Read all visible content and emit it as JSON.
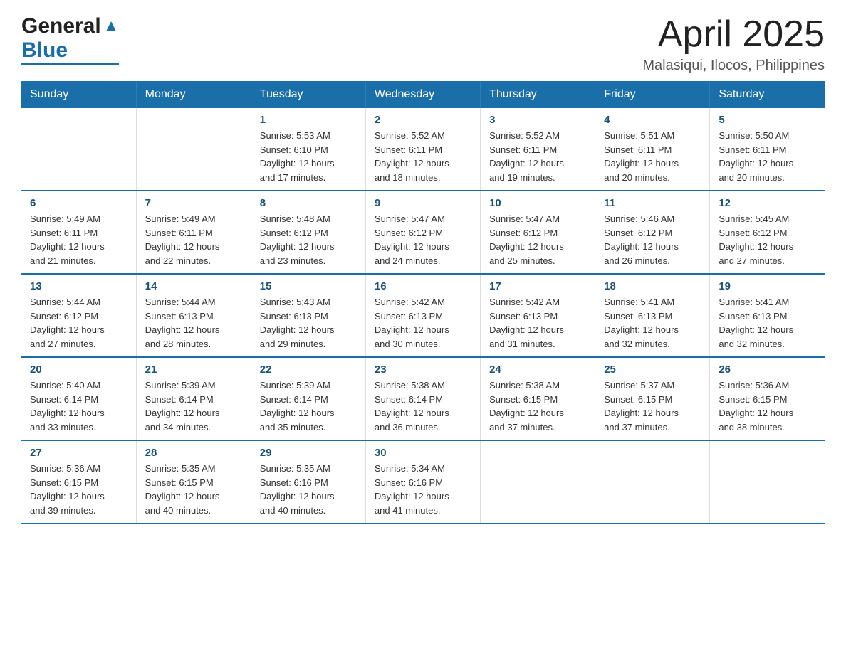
{
  "header": {
    "logo_general": "General",
    "logo_blue": "Blue",
    "title": "April 2025",
    "location": "Malasiqui, Ilocos, Philippines"
  },
  "days_of_week": [
    "Sunday",
    "Monday",
    "Tuesday",
    "Wednesday",
    "Thursday",
    "Friday",
    "Saturday"
  ],
  "weeks": [
    [
      {
        "day": "",
        "info": ""
      },
      {
        "day": "",
        "info": ""
      },
      {
        "day": "1",
        "info": "Sunrise: 5:53 AM\nSunset: 6:10 PM\nDaylight: 12 hours\nand 17 minutes."
      },
      {
        "day": "2",
        "info": "Sunrise: 5:52 AM\nSunset: 6:11 PM\nDaylight: 12 hours\nand 18 minutes."
      },
      {
        "day": "3",
        "info": "Sunrise: 5:52 AM\nSunset: 6:11 PM\nDaylight: 12 hours\nand 19 minutes."
      },
      {
        "day": "4",
        "info": "Sunrise: 5:51 AM\nSunset: 6:11 PM\nDaylight: 12 hours\nand 20 minutes."
      },
      {
        "day": "5",
        "info": "Sunrise: 5:50 AM\nSunset: 6:11 PM\nDaylight: 12 hours\nand 20 minutes."
      }
    ],
    [
      {
        "day": "6",
        "info": "Sunrise: 5:49 AM\nSunset: 6:11 PM\nDaylight: 12 hours\nand 21 minutes."
      },
      {
        "day": "7",
        "info": "Sunrise: 5:49 AM\nSunset: 6:11 PM\nDaylight: 12 hours\nand 22 minutes."
      },
      {
        "day": "8",
        "info": "Sunrise: 5:48 AM\nSunset: 6:12 PM\nDaylight: 12 hours\nand 23 minutes."
      },
      {
        "day": "9",
        "info": "Sunrise: 5:47 AM\nSunset: 6:12 PM\nDaylight: 12 hours\nand 24 minutes."
      },
      {
        "day": "10",
        "info": "Sunrise: 5:47 AM\nSunset: 6:12 PM\nDaylight: 12 hours\nand 25 minutes."
      },
      {
        "day": "11",
        "info": "Sunrise: 5:46 AM\nSunset: 6:12 PM\nDaylight: 12 hours\nand 26 minutes."
      },
      {
        "day": "12",
        "info": "Sunrise: 5:45 AM\nSunset: 6:12 PM\nDaylight: 12 hours\nand 27 minutes."
      }
    ],
    [
      {
        "day": "13",
        "info": "Sunrise: 5:44 AM\nSunset: 6:12 PM\nDaylight: 12 hours\nand 27 minutes."
      },
      {
        "day": "14",
        "info": "Sunrise: 5:44 AM\nSunset: 6:13 PM\nDaylight: 12 hours\nand 28 minutes."
      },
      {
        "day": "15",
        "info": "Sunrise: 5:43 AM\nSunset: 6:13 PM\nDaylight: 12 hours\nand 29 minutes."
      },
      {
        "day": "16",
        "info": "Sunrise: 5:42 AM\nSunset: 6:13 PM\nDaylight: 12 hours\nand 30 minutes."
      },
      {
        "day": "17",
        "info": "Sunrise: 5:42 AM\nSunset: 6:13 PM\nDaylight: 12 hours\nand 31 minutes."
      },
      {
        "day": "18",
        "info": "Sunrise: 5:41 AM\nSunset: 6:13 PM\nDaylight: 12 hours\nand 32 minutes."
      },
      {
        "day": "19",
        "info": "Sunrise: 5:41 AM\nSunset: 6:13 PM\nDaylight: 12 hours\nand 32 minutes."
      }
    ],
    [
      {
        "day": "20",
        "info": "Sunrise: 5:40 AM\nSunset: 6:14 PM\nDaylight: 12 hours\nand 33 minutes."
      },
      {
        "day": "21",
        "info": "Sunrise: 5:39 AM\nSunset: 6:14 PM\nDaylight: 12 hours\nand 34 minutes."
      },
      {
        "day": "22",
        "info": "Sunrise: 5:39 AM\nSunset: 6:14 PM\nDaylight: 12 hours\nand 35 minutes."
      },
      {
        "day": "23",
        "info": "Sunrise: 5:38 AM\nSunset: 6:14 PM\nDaylight: 12 hours\nand 36 minutes."
      },
      {
        "day": "24",
        "info": "Sunrise: 5:38 AM\nSunset: 6:15 PM\nDaylight: 12 hours\nand 37 minutes."
      },
      {
        "day": "25",
        "info": "Sunrise: 5:37 AM\nSunset: 6:15 PM\nDaylight: 12 hours\nand 37 minutes."
      },
      {
        "day": "26",
        "info": "Sunrise: 5:36 AM\nSunset: 6:15 PM\nDaylight: 12 hours\nand 38 minutes."
      }
    ],
    [
      {
        "day": "27",
        "info": "Sunrise: 5:36 AM\nSunset: 6:15 PM\nDaylight: 12 hours\nand 39 minutes."
      },
      {
        "day": "28",
        "info": "Sunrise: 5:35 AM\nSunset: 6:15 PM\nDaylight: 12 hours\nand 40 minutes."
      },
      {
        "day": "29",
        "info": "Sunrise: 5:35 AM\nSunset: 6:16 PM\nDaylight: 12 hours\nand 40 minutes."
      },
      {
        "day": "30",
        "info": "Sunrise: 5:34 AM\nSunset: 6:16 PM\nDaylight: 12 hours\nand 41 minutes."
      },
      {
        "day": "",
        "info": ""
      },
      {
        "day": "",
        "info": ""
      },
      {
        "day": "",
        "info": ""
      }
    ]
  ]
}
